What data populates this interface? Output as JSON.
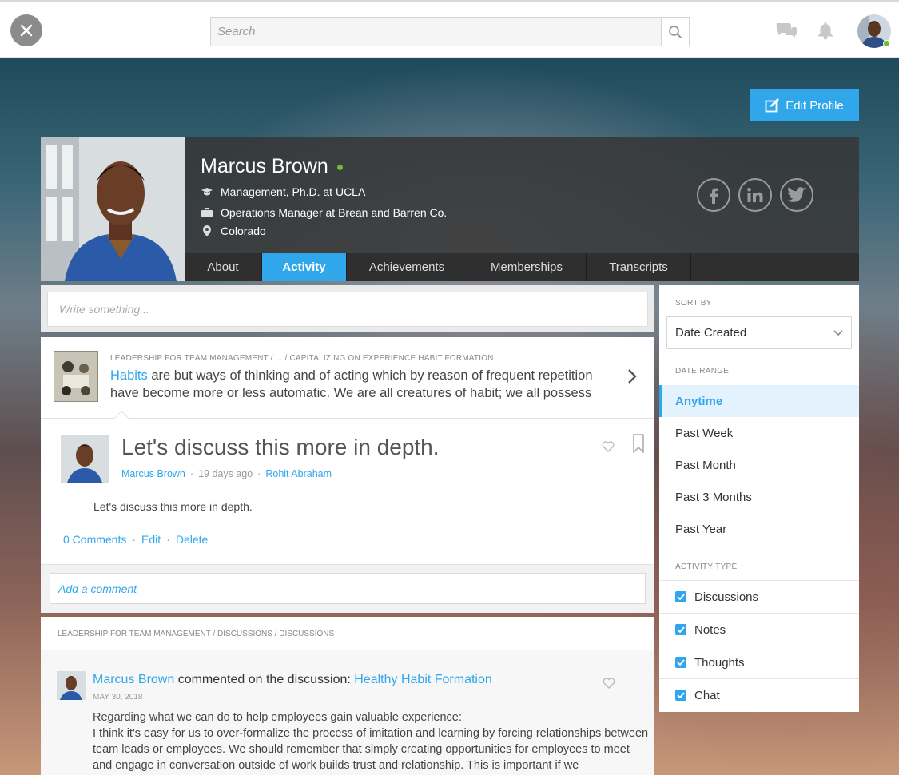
{
  "topbar": {
    "search_placeholder": "Search",
    "icons": [
      "close-icon",
      "search-icon",
      "chat-icon",
      "bell-icon"
    ]
  },
  "hero": {
    "edit_profile_label": "Edit Profile"
  },
  "profile": {
    "name": "Marcus Brown",
    "status": "online",
    "education": "Management, Ph.D. at UCLA",
    "job": "Operations Manager at Brean and Barren Co.",
    "location": "Colorado",
    "social": [
      "facebook",
      "linkedin",
      "twitter"
    ]
  },
  "tabs": [
    {
      "label": "About",
      "active": false
    },
    {
      "label": "Activity",
      "active": true
    },
    {
      "label": "Achievements",
      "active": false
    },
    {
      "label": "Memberships",
      "active": false
    },
    {
      "label": "Transcripts",
      "active": false
    }
  ],
  "composer": {
    "placeholder": "Write something..."
  },
  "post1": {
    "breadcrumb": "LEADERSHIP FOR TEAM MANAGEMENT  /  ...  /  CAPITALIZING ON EXPERIENCE HABIT FORMATION",
    "quote_highlight": "Habits",
    "quote_rest": " are but ways of thinking and of acting which by reason of frequent repetition have become more or less automatic. We are all creatures of habit; we all possess",
    "title": "Let's discuss this more in depth.",
    "author": "Marcus Brown",
    "time": "19 days ago",
    "recipient": "Rohit Abraham",
    "body": "Let's discuss this more in depth.",
    "comments_label": "0 Comments",
    "edit_label": "Edit",
    "delete_label": "Delete",
    "comment_placeholder": "Add a comment"
  },
  "post2": {
    "breadcrumb": "LEADERSHIP FOR TEAM MANAGEMENT  /  DISCUSSIONS  /  DISCUSSIONS",
    "author": "Marcus Brown",
    "action": " commented on the discussion: ",
    "discussion": "Healthy Habit Formation",
    "date": "MAY 30, 2018",
    "body_line1": "Regarding what we can do to help employees gain valuable experience:",
    "body_line2": "I think it's easy for us to over-formalize the process of imitation and learning by forcing relationships between team leads or employees. We should remember that simply creating opportunities for employees to meet and engage in conversation outside of work builds trust and relationship. This is important if we"
  },
  "filters": {
    "sort_by_label": "SORT BY",
    "sort_value": "Date Created",
    "date_range_label": "DATE RANGE",
    "date_ranges": [
      {
        "label": "Anytime",
        "active": true
      },
      {
        "label": "Past Week",
        "active": false
      },
      {
        "label": "Past Month",
        "active": false
      },
      {
        "label": "Past 3 Months",
        "active": false
      },
      {
        "label": "Past Year",
        "active": false
      }
    ],
    "activity_type_label": "ACTIVITY TYPE",
    "activity_types": [
      {
        "label": "Discussions",
        "checked": true
      },
      {
        "label": "Notes",
        "checked": true
      },
      {
        "label": "Thoughts",
        "checked": true
      },
      {
        "label": "Chat",
        "checked": true
      }
    ]
  },
  "colors": {
    "accent": "#2fa7ea",
    "online": "#6dbd2e"
  }
}
